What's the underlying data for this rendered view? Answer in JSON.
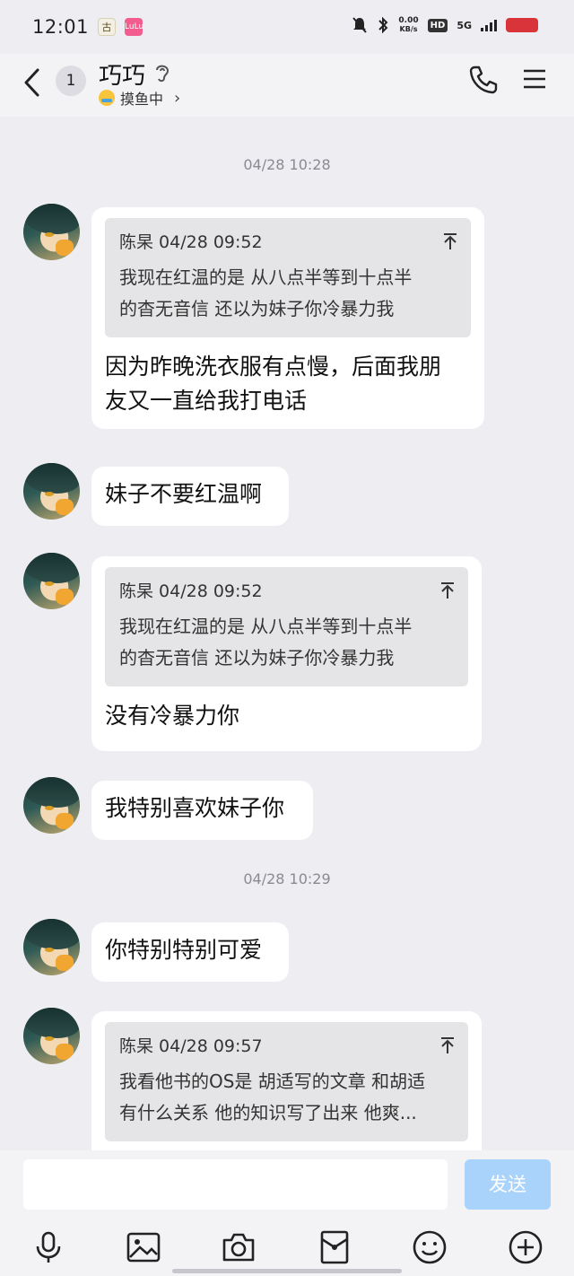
{
  "status_bar": {
    "time": "12:01",
    "app_icon_1": "古",
    "app_icon_2": "LuLu",
    "net_speed_value": "0.00",
    "net_speed_unit": "KB/s",
    "hd_label": "HD",
    "network": "5G"
  },
  "header": {
    "unread_count": "1",
    "contact_name": "巧巧",
    "status_text": "摸鱼中"
  },
  "messages": [
    {
      "timestamp": "04/28 10:28"
    },
    {
      "quote_author": "陈杲 04/28 09:52",
      "quote_text_1": "我现在红温的是 从八点半等到十点半",
      "quote_text_2": "的杳无音信 还以为妹子你冷暴力我",
      "text_1": "因为昨晚洗衣服有点慢，后面我朋",
      "text_2": "友又一直给我打电话"
    },
    {
      "text": "妹子不要红温啊"
    },
    {
      "quote_author": "陈杲 04/28 09:52",
      "quote_text_1": "我现在红温的是 从八点半等到十点半",
      "quote_text_2": "的杳无音信 还以为妹子你冷暴力我",
      "text": "没有冷暴力你"
    },
    {
      "text": "我特别喜欢妹子你"
    },
    {
      "timestamp": "04/28 10:29"
    },
    {
      "text": "你特别特别可爱"
    },
    {
      "quote_author": "陈杲 04/28 09:57",
      "quote_text_1": "我看他书的OS是 胡适写的文章 和胡适",
      "quote_text_2": "有什么关系 他的知识写了出来 他爽..."
    }
  ],
  "input": {
    "send_label": "发送",
    "placeholder": ""
  },
  "colors": {
    "background": "#eeedf2",
    "bubble": "#ffffff",
    "quote_bg": "#e5e5e7",
    "send_button": "#a9d3fb",
    "battery": "#d9343a"
  },
  "icons": [
    "back-icon",
    "ear-icon",
    "phone-icon",
    "menu-icon",
    "upward-arrow-icon",
    "mic-icon",
    "image-icon",
    "camera-icon",
    "red-packet-icon",
    "emoji-icon",
    "plus-icon"
  ]
}
